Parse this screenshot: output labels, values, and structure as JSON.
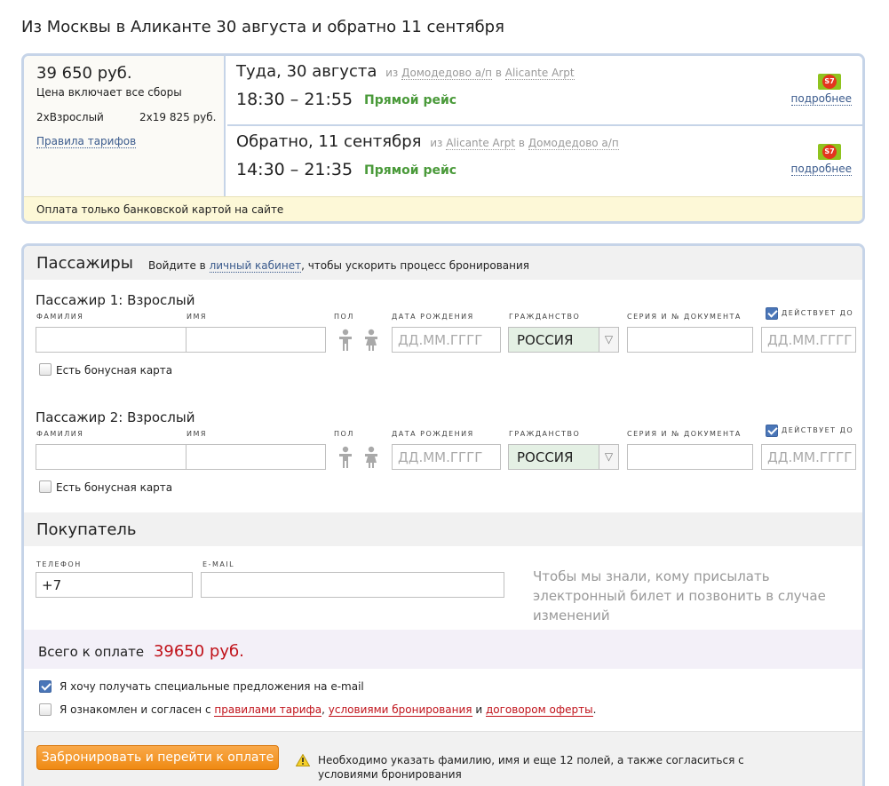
{
  "page": {
    "title": "Из Москвы в Аликанте 30 августа и обратно 11 сентября"
  },
  "summary": {
    "price": "39 650 руб.",
    "price_note": "Цена включает все сборы",
    "pax_count": "2хВзрослый",
    "pax_sum": "2х19 825 руб.",
    "tariff_rules": "Правила тарифов",
    "payment_note": "Оплата только банковской картой на сайте",
    "segments": [
      {
        "title": "Туда, 30 августа",
        "from_word": "из",
        "from": "Домодедово а/п",
        "to_word": "в",
        "to": "Alicante Arpt",
        "time": "18:30 – 21:55",
        "direct": "Прямой рейс",
        "logo": "S7",
        "more": "подробнее"
      },
      {
        "title": "Обратно, 11 сентября",
        "from_word": "из",
        "from": "Alicante Arpt",
        "to_word": "в",
        "to": "Домодедово а/п",
        "time": "14:30 – 21:35",
        "direct": "Прямой рейс",
        "logo": "S7",
        "more": "подробнее"
      }
    ]
  },
  "passengers": {
    "section_title": "Пассажиры",
    "login_prefix": "Войдите в",
    "login_link": "личный кабинет",
    "login_suffix": ", чтобы ускорить процесс бронирования",
    "labels": {
      "surname": "фамилия",
      "name": "имя",
      "gender": "пол",
      "birthdate": "дата рождения",
      "citizenship": "гражданство",
      "document": "серия и № документа",
      "valid_until": "действует до"
    },
    "birthdate_placeholder": "ДД.ММ.ГГГГ",
    "valid_placeholder": "ДД.ММ.ГГГГ",
    "bonus_card": "Есть бонусная карта",
    "items": [
      {
        "title": "Пассажир 1: Взрослый",
        "citizenship": "РОССИЯ"
      },
      {
        "title": "Пассажир 2: Взрослый",
        "citizenship": "РОССИЯ"
      }
    ]
  },
  "buyer": {
    "section_title": "Покупатель",
    "phone_label": "телефон",
    "phone_value": "+7",
    "email_label": "e-mail",
    "hint": "Чтобы мы знали, кому присылать электронный билет и позвонить в случае изменений"
  },
  "total": {
    "label": "Всего к оплате",
    "value": "39650 руб."
  },
  "agreements": {
    "offers": "Я хочу получать специальные предложения на e-mail",
    "offers_checked": true,
    "terms_prefix": "Я ознакомлен и согласен с",
    "terms_link1": "правилами тарифа",
    "terms_sep1": ",",
    "terms_link2": "условиями бронирования",
    "terms_sep2": "и",
    "terms_link3": "договором оферты",
    "terms_end": ".",
    "terms_checked": false
  },
  "actions": {
    "book_button": "Забронировать и перейти к оплате",
    "warning": "Необходимо указать фамилию, имя и еще 12 полей, а также согласиться с условиями бронирования"
  },
  "colors": {
    "accent_border": "#c6d4e8",
    "direct_green": "#4a9a3a",
    "total_red": "#c0121a",
    "button_orange": "#ef8a13"
  }
}
